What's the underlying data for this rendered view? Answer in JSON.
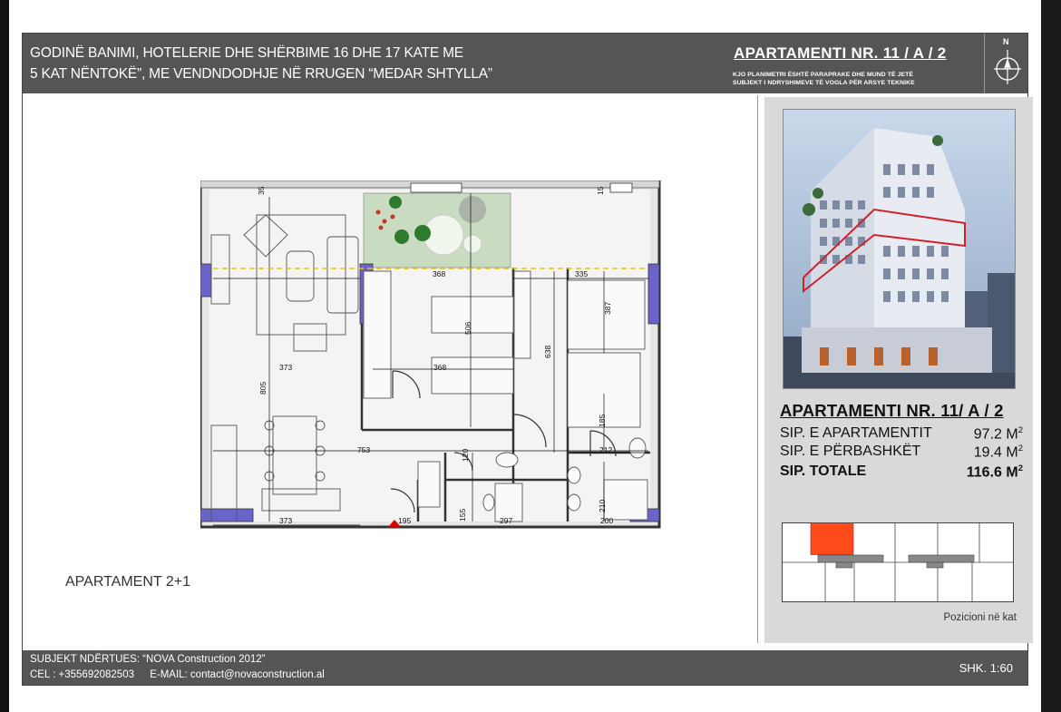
{
  "header": {
    "title_line1": "GODINË BANIMI, HOTELERIE DHE SHËRBIME 16 DHE 17 KATE ME",
    "title_line2": "5 KAT NËNTOKË”, ME VENDNDODHJE NË RRUGEN “MEDAR SHTYLLA”",
    "apartment_title": "APARTAMENTI NR. 11 / A / 2",
    "note_line1": "KJO PLANIMETRI ËSHTË PARAPRAKE DHE MUND TË JETË",
    "note_line2": "SUBJEKT I NDRYSHIMEVE TË VOGLA PËR ARSYE TEKNIKE",
    "compass_label": "N",
    "compass_icon": "compass-north-icon"
  },
  "plan": {
    "dimensions": [
      "35",
      "15",
      "368",
      "335",
      "387",
      "506",
      "638",
      "805",
      "373",
      "368",
      "753",
      "185",
      "212",
      "120",
      "210",
      "155",
      "297",
      "200",
      "195",
      "373"
    ]
  },
  "apartment_type": "APARTAMENT 2+1",
  "info": {
    "name": "APARTAMENTI  NR. 11/ A / 2",
    "rows": [
      {
        "label": "SIP. E APARTAMENTIT",
        "value": "97.2 M",
        "unit_sup": "2",
        "bold": false
      },
      {
        "label": "SIP. E PËRBASHKËT",
        "value": "19.4 M",
        "unit_sup": "2",
        "bold": false
      },
      {
        "label": "SIP. TOTALE",
        "value": "116.6 M",
        "unit_sup": "2",
        "bold": true
      }
    ],
    "position_label": "Pozicioni në kat",
    "highlight_color": "#ff4a1c"
  },
  "footer": {
    "builder": "SUBJEKT NDËRTUES: “NOVA Construction 2012”",
    "phone": "CEL : +355692082503",
    "email": "E-MAIL: contact@novaconstruction.al",
    "scale": "SHK. 1:60"
  }
}
